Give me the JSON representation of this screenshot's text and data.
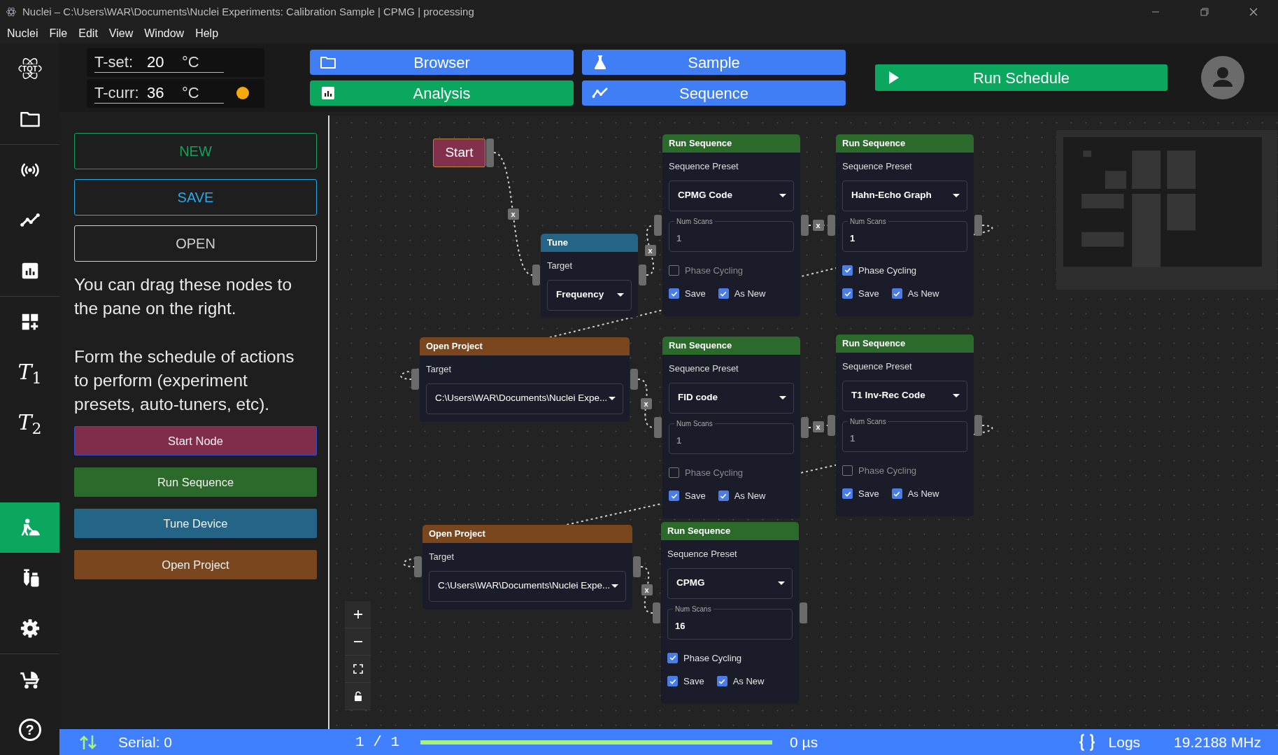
{
  "window": {
    "title": "Nuclei – C:\\Users\\WAR\\Documents\\Nuclei Experiments: Calibration Sample | CPMG | processing"
  },
  "menu": [
    "Nuclei",
    "File",
    "Edit",
    "View",
    "Window",
    "Help"
  ],
  "rail": {
    "logo_text": "TQT",
    "items": [
      {
        "kind": "icon",
        "selected": false
      },
      {
        "kind": "icon",
        "selected": false
      },
      {
        "kind": "icon",
        "selected": false
      },
      {
        "kind": "icon",
        "selected": false
      },
      {
        "kind": "icon",
        "selected": false
      },
      {
        "kind": "math",
        "label": "*T*$_{1}$",
        "selected": false
      },
      {
        "kind": "math",
        "label": "*T*$_{2}$",
        "selected": false
      },
      {
        "kind": "icon",
        "selected": true
      },
      {
        "kind": "icon",
        "selected": false
      },
      {
        "kind": "icon",
        "selected": false
      },
      {
        "kind": "icon",
        "selected": false
      },
      {
        "kind": "glyph",
        "label": "?",
        "selected": false
      }
    ]
  },
  "temperature": {
    "set": {
      "label": "T-set:",
      "value": "20",
      "unit": "°C"
    },
    "current": {
      "label": "T-curr:",
      "value": "36",
      "unit": "°C",
      "color": "#f5a90c"
    }
  },
  "nav": [
    {
      "label": "Browser",
      "color": "#3f7ef5"
    },
    {
      "label": "Sample",
      "color": "#3f7ef5"
    },
    {
      "label": "Analysis",
      "color": "#0ba75f"
    },
    {
      "label": "Sequence",
      "color": "#3f7ef5"
    }
  ],
  "run_button": {
    "label": "Run Schedule"
  },
  "panel": {
    "actions": [
      {
        "label": "NEW",
        "color": "#13a05a"
      },
      {
        "label": "SAVE",
        "color": "#2aa7e6"
      },
      {
        "label": "OPEN",
        "color": "#d0d0d0"
      }
    ],
    "paragraphs": [
      "You can drag these nodes to the pane on the right.",
      "Form the schedule of actions to perform (experiment presets, auto-tuners, etc)."
    ],
    "palette": [
      {
        "label": "Start Node",
        "color": "#7f2d4a"
      },
      {
        "label": "Run Sequence",
        "color": "#2c6a2c"
      },
      {
        "label": "Tune Device",
        "color": "#236487"
      },
      {
        "label": "Open Project",
        "color": "#7a461e"
      }
    ]
  },
  "canvas": {
    "nodes": [
      {
        "kind": "start",
        "title": "Start"
      },
      {
        "kind": "tune",
        "title": "Tune",
        "target_label": "Target",
        "target": "Frequency"
      },
      {
        "kind": "run_sequence",
        "title": "Run Sequence",
        "preset_label": "Sequence Preset",
        "preset": "CPMG Code",
        "num_scans_label": "Num Scans",
        "num_scans_placeholder": "1",
        "phase_cycling": {
          "label": "Phase Cycling",
          "checked": false
        },
        "save": {
          "label": "Save",
          "checked": true
        },
        "as_new": {
          "label": "As New",
          "checked": true
        }
      },
      {
        "kind": "run_sequence",
        "title": "Run Sequence",
        "preset_label": "Sequence Preset",
        "preset": "Hahn-Echo Graph",
        "num_scans_label": "Num Scans",
        "num_scans": "1",
        "phase_cycling": {
          "label": "Phase Cycling",
          "checked": true
        },
        "save": {
          "label": "Save",
          "checked": true
        },
        "as_new": {
          "label": "As New",
          "checked": true
        }
      },
      {
        "kind": "open_project",
        "title": "Open Project",
        "target_label": "Target",
        "target": "C:\\Users\\WAR\\Documents\\Nuclei Expe..."
      },
      {
        "kind": "run_sequence",
        "title": "Run Sequence",
        "preset_label": "Sequence Preset",
        "preset": "FID code",
        "num_scans_label": "Num Scans",
        "num_scans_placeholder": "1",
        "phase_cycling": {
          "label": "Phase Cycling",
          "checked": false
        },
        "save": {
          "label": "Save",
          "checked": true
        },
        "as_new": {
          "label": "As New",
          "checked": true
        }
      },
      {
        "kind": "run_sequence",
        "title": "Run Sequence",
        "preset_label": "Sequence Preset",
        "preset": "T1 Inv-Rec Code",
        "num_scans_label": "Num Scans",
        "num_scans_placeholder": "1",
        "phase_cycling": {
          "label": "Phase Cycling",
          "checked": false
        },
        "save": {
          "label": "Save",
          "checked": true
        },
        "as_new": {
          "label": "As New",
          "checked": true
        }
      },
      {
        "kind": "open_project",
        "title": "Open Project",
        "target_label": "Target",
        "target": "C:\\Users\\WAR\\Documents\\Nuclei Expe..."
      },
      {
        "kind": "run_sequence",
        "title": "Run Sequence",
        "preset_label": "Sequence Preset",
        "preset": "CPMG",
        "num_scans_label": "Num Scans",
        "num_scans": "16",
        "phase_cycling": {
          "label": "Phase Cycling",
          "checked": true
        },
        "save": {
          "label": "Save",
          "checked": true
        },
        "as_new": {
          "label": "As New",
          "checked": true
        }
      }
    ],
    "connectors": [
      {
        "remove_label": "x"
      },
      {
        "remove_label": "x"
      },
      {
        "remove_label": "x"
      },
      {
        "remove_label": "x"
      },
      {
        "remove_label": "x"
      },
      {
        "remove_label": "x"
      }
    ]
  },
  "status_bar": {
    "serial": "Serial: 0",
    "progress_text": "1 / 1",
    "level": 1.0,
    "duration": "0 µs",
    "logs": "Logs",
    "frequency": "19.2188 MHz"
  }
}
